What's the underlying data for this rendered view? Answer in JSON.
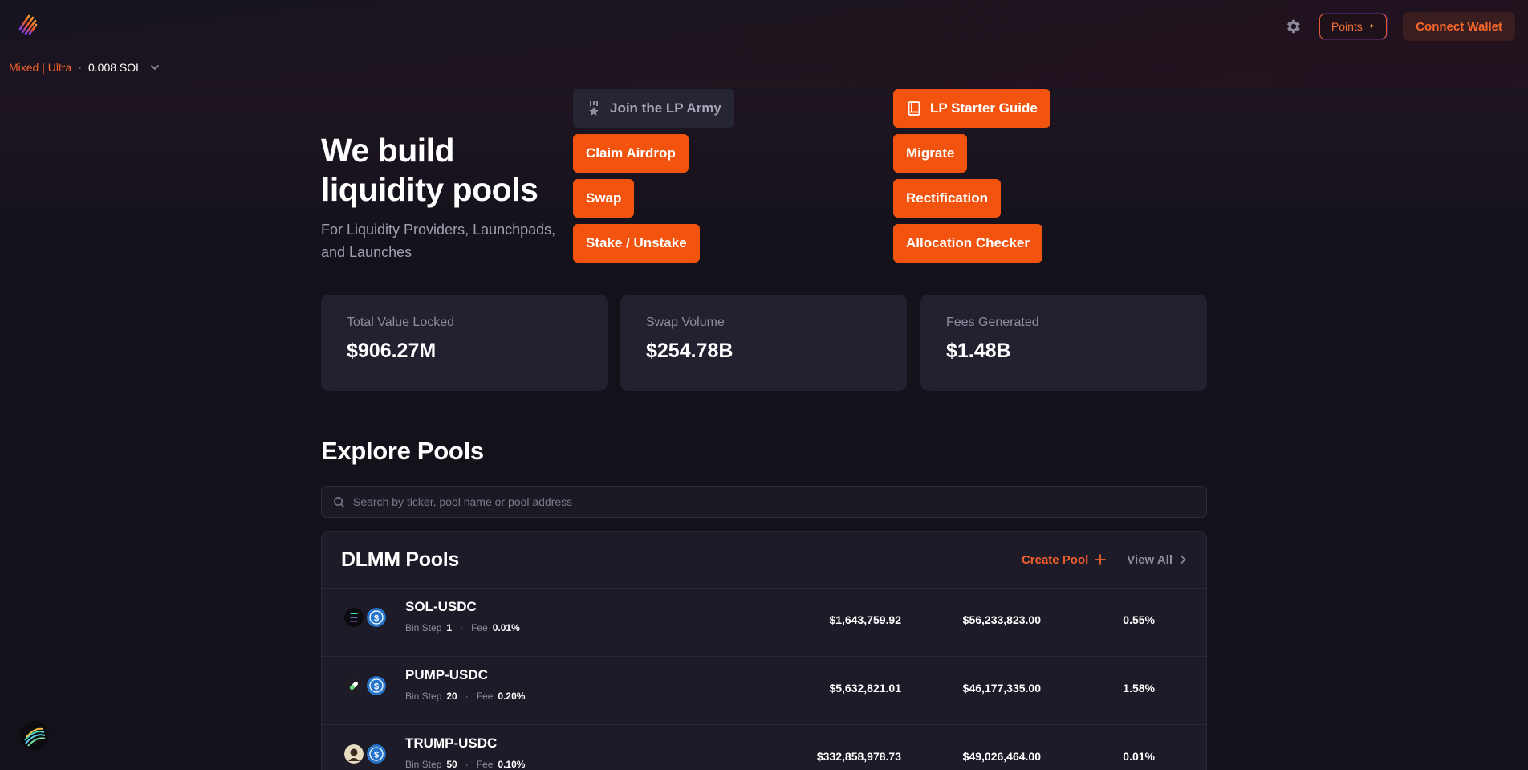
{
  "header": {
    "logo_icon": "meteora-logo-icon",
    "settings_icon": "gear-icon",
    "points_label": "Points",
    "points_icon": "sparkle-icon",
    "connect_label": "Connect Wallet",
    "mode_label": "Mixed | Ultra",
    "separator": "·",
    "sol_balance": "0.008 SOL"
  },
  "hero": {
    "title_line1": "We build",
    "title_line2": "liquidity pools",
    "subtitle_line1": "For Liquidity Providers, Launchpads,",
    "subtitle_line2": "and Launches"
  },
  "buttons": {
    "join": "Join the LP Army",
    "guide": "LP Starter Guide",
    "claim": "Claim Airdrop",
    "migrate": "Migrate",
    "swap": "Swap",
    "rectification": "Rectification",
    "stake": "Stake / Unstake",
    "allocation": "Allocation Checker"
  },
  "stats": [
    {
      "label": "Total Value Locked",
      "value": "$906.27M"
    },
    {
      "label": "Swap Volume",
      "value": "$254.78B"
    },
    {
      "label": "Fees Generated",
      "value": "$1.48B"
    }
  ],
  "explore": {
    "title": "Explore Pools",
    "search_placeholder": "Search by ticker, pool name or pool address"
  },
  "dlmm": {
    "title": "DLMM Pools",
    "create_label": "Create Pool",
    "view_all_label": "View All",
    "bin_step_label": "Bin Step",
    "fee_label": "Fee",
    "rows": [
      {
        "name": "SOL-USDC",
        "bin_step": "1",
        "fee": "0.01%",
        "tvl": "$1,643,759.92",
        "volume": "$56,233,823.00",
        "apr": "0.55%"
      },
      {
        "name": "PUMP-USDC",
        "bin_step": "20",
        "fee": "0.20%",
        "tvl": "$5,632,821.01",
        "volume": "$46,177,335.00",
        "apr": "1.58%"
      },
      {
        "name": "TRUMP-USDC",
        "bin_step": "50",
        "fee": "0.10%",
        "tvl": "$332,858,978.73",
        "volume": "$49,026,464.00",
        "apr": "0.01%"
      }
    ]
  },
  "colors": {
    "accent": "#f25410",
    "background": "#13121b",
    "card": "#222130"
  }
}
